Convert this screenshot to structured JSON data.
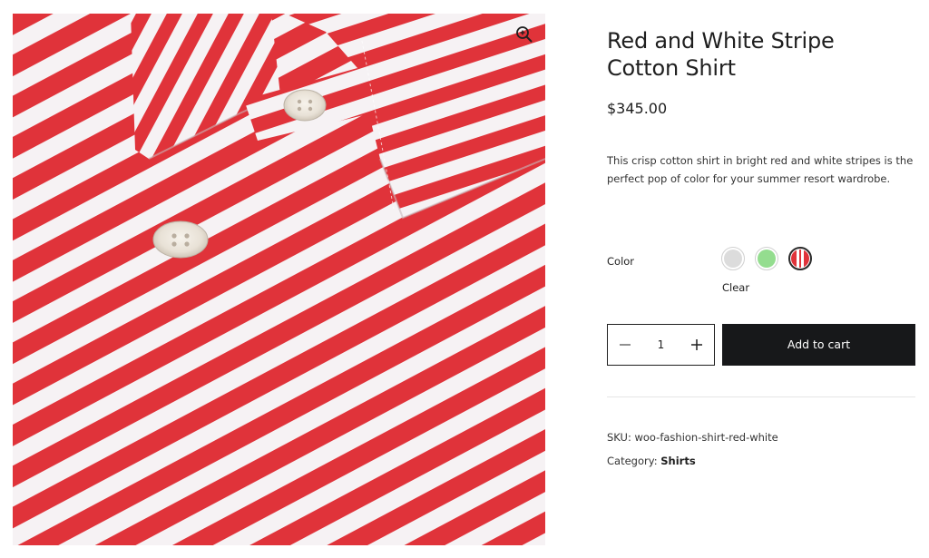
{
  "product": {
    "title_line1": "Red and White Stripe",
    "title_line2": "Cotton Shirt",
    "price": "$345.00",
    "description_line1": "This crisp cotton shirt in bright red and white stripes is the",
    "description_line2": "perfect pop of color for your summer resort wardrobe.",
    "image_icon": "magnify-zoom-icon"
  },
  "variation": {
    "label": "Color",
    "swatches": [
      {
        "name": "gray",
        "color": "#dcdcdc",
        "selected": false
      },
      {
        "name": "green",
        "color": "#94dd8f",
        "selected": false
      },
      {
        "name": "red-white-stripe",
        "color": "#e0333a",
        "selected": true
      }
    ],
    "clear_label": "Clear"
  },
  "cart": {
    "quantity": "1",
    "add_to_cart_label": "Add to cart"
  },
  "meta": {
    "sku_label": "SKU:",
    "sku_value": "woo-fashion-shirt-red-white",
    "category_label": "Category:",
    "category_value": "Shirts"
  },
  "colors": {
    "stripe_red": "#e0333a",
    "stripe_white": "#f6f2f4",
    "button_dark": "#17181a"
  }
}
